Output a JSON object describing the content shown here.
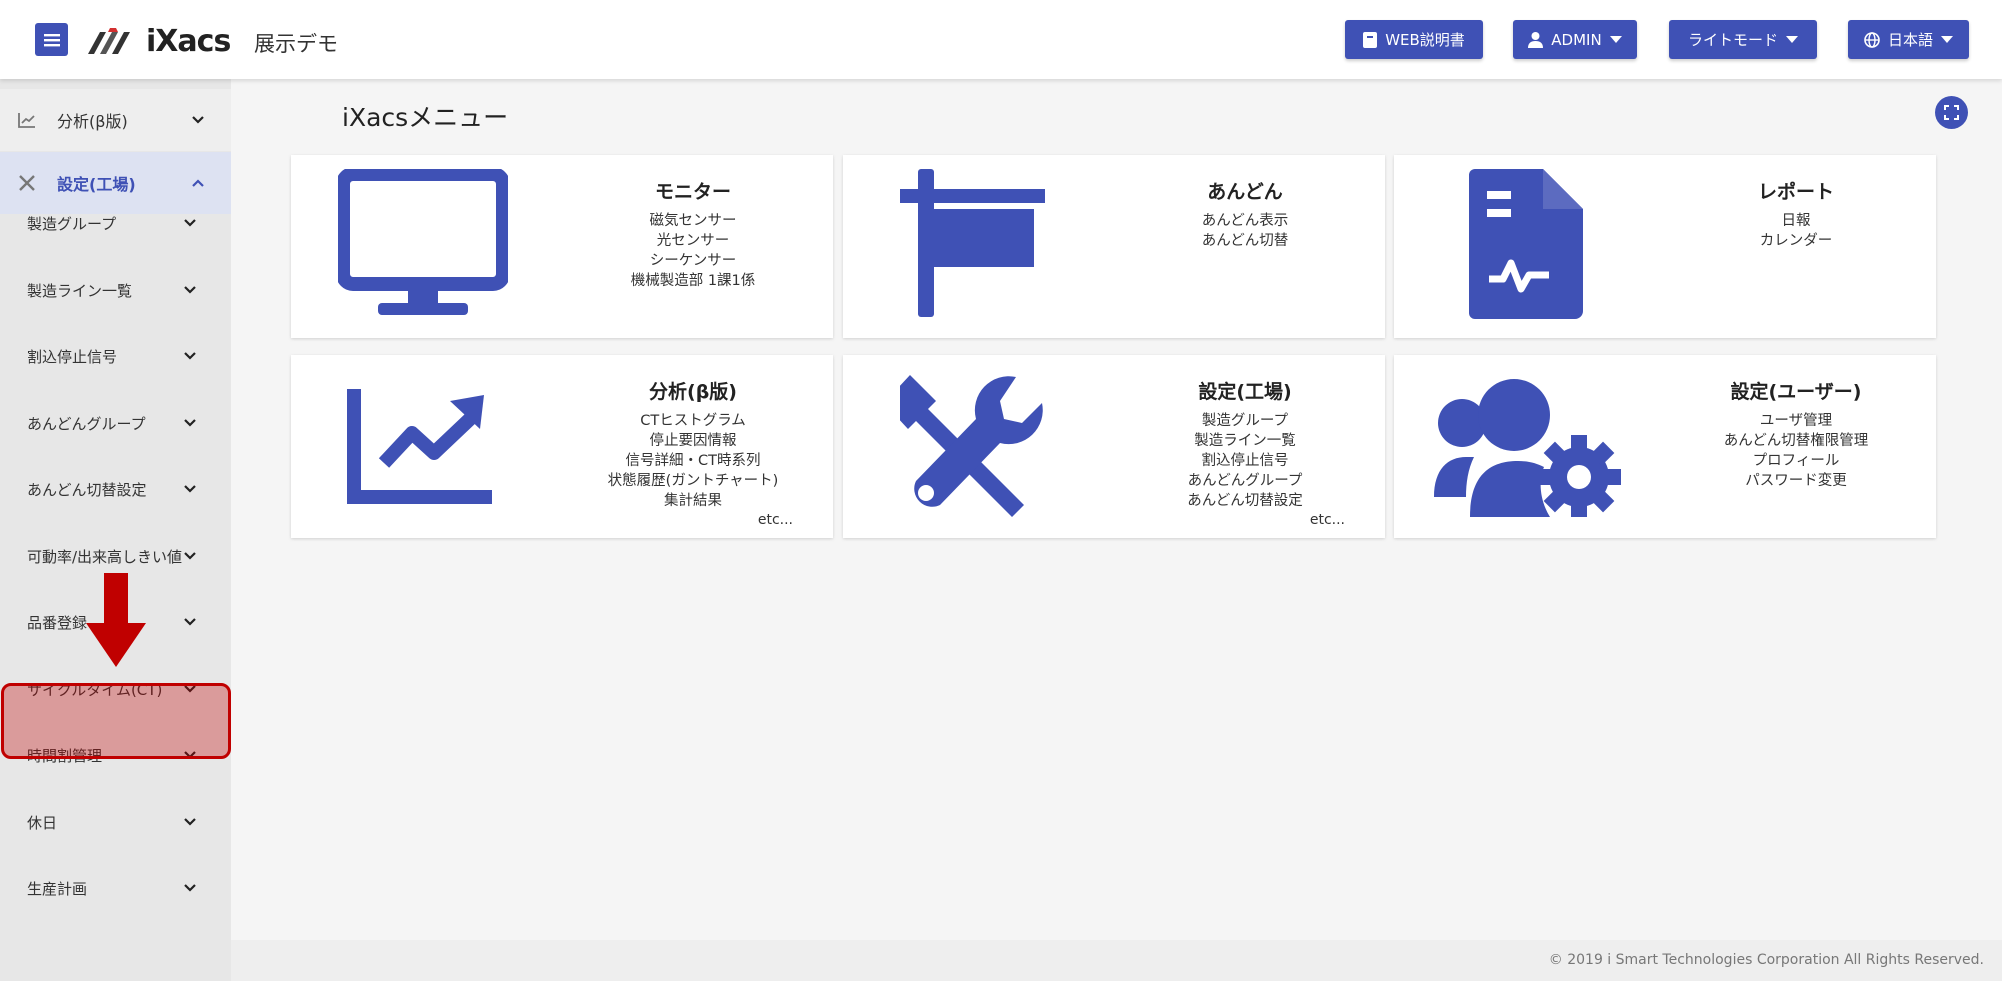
{
  "header": {
    "logo_text": "iXacs",
    "demo_title": "展示デモ",
    "buttons": {
      "manual": "WEB説明書",
      "user": "ADMIN",
      "theme": "ライトモード",
      "language": "日本語"
    }
  },
  "sidebar": {
    "top_items": [
      {
        "label": "分析(β版)",
        "icon": "chart-line-icon"
      },
      {
        "label": "設定(工場)",
        "icon": "tools-icon"
      }
    ],
    "sub_items": [
      "製造グループ",
      "製造ライン一覧",
      "割込停止信号",
      "あんどんグループ",
      "あんどん切替設定",
      "可動率/出来高しきい値",
      "品番登録",
      "サイクルタイム(CT)",
      "時間割管理",
      "休日",
      "生産計画"
    ],
    "highlighted_item": "サイクルタイム(CT)"
  },
  "main": {
    "title": "iXacsメニュー",
    "cards": [
      {
        "title": "モニター",
        "lines": [
          "磁気センサー",
          "光センサー",
          "シーケンサー",
          "機械製造部 1課1係"
        ],
        "etc": "",
        "icon": "monitor-icon"
      },
      {
        "title": "あんどん",
        "lines": [
          "あんどん表示",
          "あんどん切替"
        ],
        "etc": "",
        "icon": "flag-icon"
      },
      {
        "title": "レポート",
        "lines": [
          "日報",
          "カレンダー"
        ],
        "etc": "",
        "icon": "report-icon"
      },
      {
        "title": "分析(β版)",
        "lines": [
          "CTヒストグラム",
          "停止要因情報",
          "信号詳細・CT時系列",
          "状態履歴(ガントチャート)",
          "集計結果"
        ],
        "etc": "etc...",
        "icon": "chart-line-icon"
      },
      {
        "title": "設定(工場)",
        "lines": [
          "製造グループ",
          "製造ライン一覧",
          "割込停止信号",
          "あんどんグループ",
          "あんどん切替設定"
        ],
        "etc": "etc...",
        "icon": "tools-icon"
      },
      {
        "title": "設定(ユーザー)",
        "lines": [
          "ユーザ管理",
          "あんどん切替権限管理",
          "プロフィール",
          "パスワード変更"
        ],
        "etc": "",
        "icon": "users-cog-icon"
      }
    ]
  },
  "footer": {
    "copyright": "© 2019 i Smart Technologies Corporation All Rights Reserved."
  },
  "colors": {
    "accent": "#3f51b5",
    "highlight": "#c00000"
  }
}
